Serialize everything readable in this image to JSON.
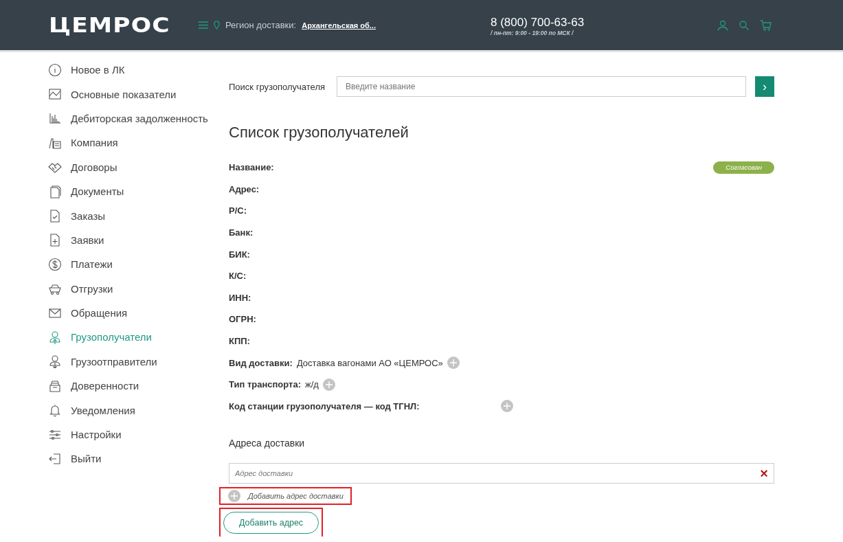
{
  "header": {
    "logo": "ЦЕМРОС",
    "region_label": "Регион доставки:",
    "region_value": "Архангельская об...",
    "phone": "8 (800) 700-63-63",
    "hours": "/ пн-пт: 9:00 - 19:00 по МСК  /"
  },
  "sidebar": {
    "items": [
      {
        "label": "Новое в ЛК",
        "selected": false
      },
      {
        "label": "Основные показатели",
        "selected": false
      },
      {
        "label": "Дебиторская задолженность",
        "selected": false
      },
      {
        "label": "Компания",
        "selected": false
      },
      {
        "label": "Договоры",
        "selected": false
      },
      {
        "label": "Документы",
        "selected": false
      },
      {
        "label": "Заказы",
        "selected": false
      },
      {
        "label": "Заявки",
        "selected": false
      },
      {
        "label": "Платежи",
        "selected": false
      },
      {
        "label": "Отгрузки",
        "selected": false
      },
      {
        "label": "Обращения",
        "selected": false
      },
      {
        "label": "Грузополучатели",
        "selected": true
      },
      {
        "label": "Грузоотправители",
        "selected": false
      },
      {
        "label": "Доверенности",
        "selected": false
      },
      {
        "label": "Уведомления",
        "selected": false
      },
      {
        "label": "Настройки",
        "selected": false
      },
      {
        "label": "Выйти",
        "selected": false
      }
    ]
  },
  "search": {
    "label": "Поиск грузополучателя",
    "placeholder": "Введите название",
    "button": "›"
  },
  "title": "Список грузополучателей",
  "status_badge": "Согласован",
  "fields": [
    {
      "label": "Название:",
      "kind": "plain"
    },
    {
      "label": "Адрес:",
      "kind": "plain"
    },
    {
      "label": "Р/С:",
      "kind": "plain"
    },
    {
      "label": "Банк:",
      "kind": "plain"
    },
    {
      "label": "БИК:",
      "kind": "plain"
    },
    {
      "label": "К/С:",
      "kind": "plain"
    },
    {
      "label": "ИНН:",
      "kind": "plain"
    },
    {
      "label": "ОГРН:",
      "kind": "plain"
    },
    {
      "label": "КПП:",
      "kind": "plain"
    },
    {
      "label": "Вид доставки:",
      "value": "Доставка вагонами АО «ЦЕМРОС»",
      "kind": "add"
    },
    {
      "label": "Тип транспорта:",
      "value": "ж/д",
      "kind": "add"
    },
    {
      "label": "Код станции грузополучателя — код ТГНЛ:",
      "kind": "add-far"
    }
  ],
  "addresses": {
    "heading": "Адреса доставки",
    "placeholder": "Адрес доставки",
    "remove": "×",
    "add_link": {
      "label": "Добавить адрес доставки",
      "highlighted": true
    },
    "add_button": {
      "label": "Добавить адрес",
      "highlighted": true
    }
  }
}
